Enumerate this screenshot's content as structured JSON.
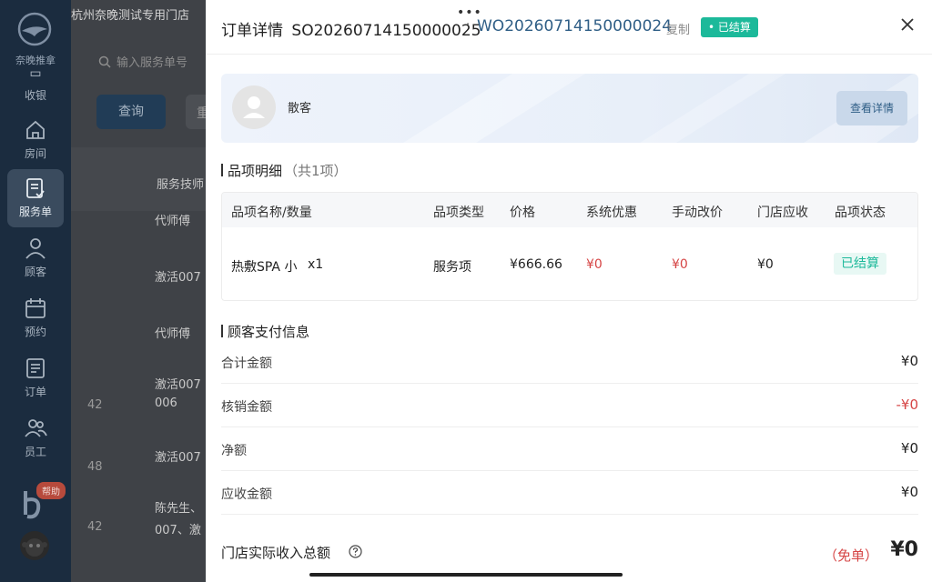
{
  "sidebar": {
    "brand": "奈晚推拿",
    "items": [
      {
        "label": "收银",
        "icon": "cashier-icon"
      },
      {
        "label": "房间",
        "icon": "house-icon"
      },
      {
        "label": "服务单",
        "icon": "service-order-icon"
      },
      {
        "label": "顾客",
        "icon": "user-icon"
      },
      {
        "label": "预约",
        "icon": "calendar-icon"
      },
      {
        "label": "订单",
        "icon": "order-icon"
      },
      {
        "label": "员工",
        "icon": "staff-icon"
      }
    ],
    "help_label": "帮助",
    "colors": {
      "bg": "#1b2c3f",
      "active": "#3a4b5e"
    }
  },
  "background_page": {
    "store_name": "杭州奈晚测试专用门店",
    "search_placeholder": "输入服务单号",
    "query_button": "查询",
    "reset_button": "重",
    "column_header": "服务技师",
    "cells": [
      "代师傅",
      "激活007",
      "代师傅",
      "激活007",
      "006",
      "激活007",
      "陈先生、",
      "007、激"
    ],
    "row_fragments": [
      "42",
      "48",
      "42"
    ]
  },
  "drawer": {
    "title": "订单详情",
    "order_no": "SO20260714150000025",
    "separator": "·",
    "wo_no": "WO20260714150000024",
    "copy_label": "复制",
    "status_badge": "• 已结算",
    "customer": {
      "name": "散客",
      "detail_button": "查看详情"
    },
    "items_section": {
      "title": "品项明细",
      "count": "（共1项）",
      "headers": [
        "品项名称/数量",
        "品项类型",
        "价格",
        "系统优惠",
        "手动改价",
        "门店应收",
        "品项状态"
      ],
      "rows": [
        {
          "name": "热敷SPA 小",
          "qty": "x1",
          "type": "服务项",
          "price": "¥666.66",
          "system_discount": "¥0",
          "manual_change": "¥0",
          "store_receivable": "¥0",
          "status": "已结算"
        }
      ]
    },
    "payment_section": {
      "title": "顾客支付信息",
      "rows": [
        {
          "label": "合计金额",
          "value": "¥0"
        },
        {
          "label": "核销金额",
          "value": "-¥0"
        },
        {
          "label": "净额",
          "value": "¥0"
        },
        {
          "label": "应收金额",
          "value": "¥0"
        }
      ],
      "total_label": "门店实际收入总额",
      "total_note": "（免单）",
      "total_value": "¥0"
    },
    "colors": {
      "accent_blue": "#2f5e86",
      "success": "#1cb99a",
      "danger": "#d64545"
    }
  }
}
